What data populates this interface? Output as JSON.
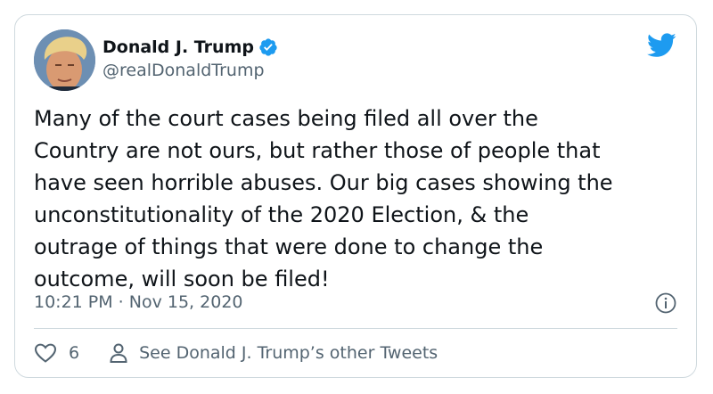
{
  "tweet": {
    "author_name": "Donald J. Trump",
    "handle": "@realDonaldTrump",
    "verified": true,
    "text": "Many of the court cases being filed all over the\nCountry are not ours, but rather those of people that\nhave seen horrible abuses. Our big cases showing the\nunconstitutionality of the 2020 Election, & the\noutrage of things that were done to change the\noutcome, will soon be filed!",
    "timestamp": "10:21 PM · Nov 15, 2020",
    "like_count": "6",
    "other_tweets_label": "See Donald J. Trump’s other Tweets"
  },
  "icons": {
    "brand": "twitter-bird-icon",
    "verified": "verified-badge-icon",
    "info": "info-icon",
    "like": "heart-icon",
    "profile": "person-icon"
  },
  "colors": {
    "brand": "#1d9bf0",
    "text": "#0f1419",
    "secondary": "#536471",
    "border": "#cfd9de"
  }
}
